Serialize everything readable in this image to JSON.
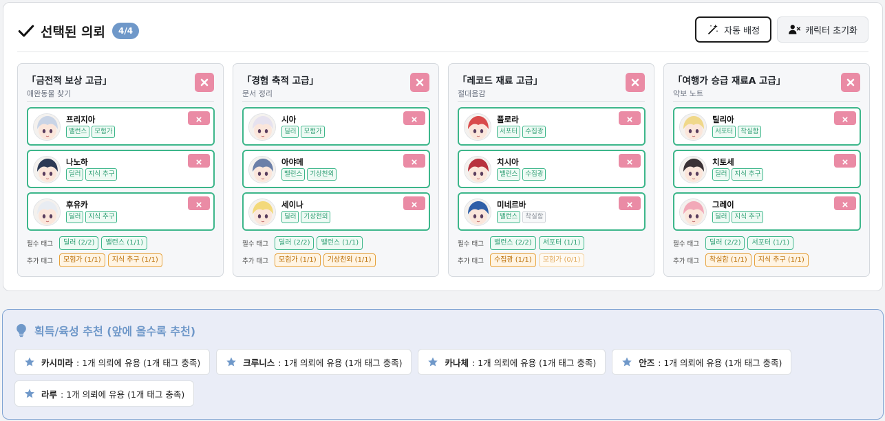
{
  "header": {
    "title": "선택된 의뢰",
    "count": "4/4",
    "auto_assign": "자동 배정",
    "reset_chars": "캐릭터 초기화"
  },
  "labels": {
    "required": "필수 태그",
    "extra": "추가 태그"
  },
  "requests": [
    {
      "title": "「금전적 보상 고급」",
      "subtitle": "애완동물 찾기",
      "characters": [
        {
          "name": "프리지아",
          "tags": [
            "밸런스",
            "모험가"
          ],
          "avatar": "#c9d4e6"
        },
        {
          "name": "나노하",
          "tags": [
            "딜러",
            "지식 추구"
          ],
          "avatar": "#2d3a55"
        },
        {
          "name": "후유카",
          "tags": [
            "딜러",
            "지식 추구"
          ],
          "avatar": "#e8ecf2"
        }
      ],
      "required": [
        {
          "text": "딜러 (2/2)",
          "state": "ok"
        },
        {
          "text": "밸런스 (1/1)",
          "state": "ok"
        }
      ],
      "extra": [
        {
          "text": "모험가 (1/1)",
          "state": "warn"
        },
        {
          "text": "지식 추구 (1/1)",
          "state": "warn"
        }
      ]
    },
    {
      "title": "「경험 축적 고급」",
      "subtitle": "문서 정리",
      "characters": [
        {
          "name": "시아",
          "tags": [
            "딜러",
            "모험가"
          ],
          "avatar": "#e6e2ef"
        },
        {
          "name": "아야메",
          "tags": [
            "밸런스",
            "기상천외"
          ],
          "avatar": "#6b7fa8"
        },
        {
          "name": "세이나",
          "tags": [
            "딜러",
            "기상천외"
          ],
          "avatar": "#f3d97b"
        }
      ],
      "required": [
        {
          "text": "딜러 (2/2)",
          "state": "ok"
        },
        {
          "text": "밸런스 (1/1)",
          "state": "ok"
        }
      ],
      "extra": [
        {
          "text": "모험가 (1/1)",
          "state": "warn"
        },
        {
          "text": "기상천외 (1/1)",
          "state": "warn"
        }
      ]
    },
    {
      "title": "「레코드 재료 고급」",
      "subtitle": "절대음감",
      "characters": [
        {
          "name": "플로라",
          "tags": [
            "서포터",
            "수집광"
          ],
          "avatar": "#d94b4b"
        },
        {
          "name": "치시아",
          "tags": [
            "밸런스",
            "수집광"
          ],
          "avatar": "#b8323e"
        },
        {
          "name": "미네르바",
          "tags": [
            "밸런스",
            "착실함"
          ],
          "avatar": "#2f5fa8",
          "dim_tag": 1
        }
      ],
      "required": [
        {
          "text": "밸런스 (2/2)",
          "state": "ok"
        },
        {
          "text": "서포터 (1/1)",
          "state": "ok"
        }
      ],
      "extra": [
        {
          "text": "수집광 (1/1)",
          "state": "warn"
        },
        {
          "text": "모험가 (0/1)",
          "state": "dim"
        }
      ]
    },
    {
      "title": "「여행가 승급 재료A 고급」",
      "subtitle": "악보 노트",
      "characters": [
        {
          "name": "틸리아",
          "tags": [
            "서포터",
            "착실함"
          ],
          "avatar": "#f0d88a"
        },
        {
          "name": "치토세",
          "tags": [
            "딜러",
            "지식 추구"
          ],
          "avatar": "#3a3236"
        },
        {
          "name": "그레이",
          "tags": [
            "딜러",
            "지식 추구"
          ],
          "avatar": "#f2a9b8"
        }
      ],
      "required": [
        {
          "text": "딜러 (2/2)",
          "state": "ok"
        },
        {
          "text": "서포터 (1/1)",
          "state": "ok"
        }
      ],
      "extra": [
        {
          "text": "착실함 (1/1)",
          "state": "warn"
        },
        {
          "text": "지식 추구 (1/1)",
          "state": "warn"
        }
      ]
    }
  ],
  "recommend": {
    "title": "획득/육성 추천 (앞에 올수록 추천)",
    "items": [
      {
        "name": "카시미라",
        "desc": ": 1개 의뢰에 유용 (1개 태그 충족)"
      },
      {
        "name": "크루니스",
        "desc": ": 1개 의뢰에 유용 (1개 태그 충족)"
      },
      {
        "name": "카나체",
        "desc": ": 1개 의뢰에 유용 (1개 태그 충족)"
      },
      {
        "name": "안즈",
        "desc": ": 1개 의뢰에 유용 (1개 태그 충족)"
      },
      {
        "name": "라루",
        "desc": ": 1개 의뢰에 유용 (1개 태그 충족)"
      }
    ]
  },
  "colors": {
    "accent": "#6f98c9",
    "slot_border": "#3cb68a",
    "remove": "#ea8ba5",
    "warn": "#e6a23c"
  },
  "icons": {
    "title": "check-icon",
    "auto": "magic-wand-icon",
    "reset": "user-x-icon",
    "remove": "close-icon",
    "recommend": "lightbulb-icon",
    "item": "star-icon"
  }
}
